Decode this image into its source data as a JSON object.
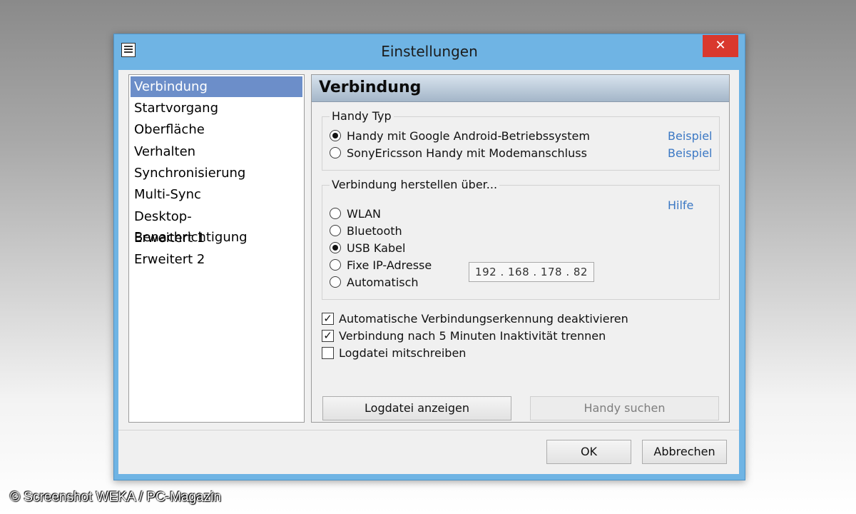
{
  "window": {
    "title": "Einstellungen",
    "close_symbol": "✕",
    "app_icon": "list-icon"
  },
  "nav": {
    "items": [
      {
        "label": "Verbindung",
        "selected": true
      },
      {
        "label": "Startvorgang"
      },
      {
        "label": "Oberfläche"
      },
      {
        "label": "Verhalten"
      },
      {
        "label": "Synchronisierung"
      },
      {
        "label": "Multi-Sync"
      },
      {
        "label": "Desktop-Benachrichtigung"
      },
      {
        "label": "Erweitert 1"
      },
      {
        "label": "Erweitert 2"
      }
    ]
  },
  "panel": {
    "title": "Verbindung",
    "handy_typ": {
      "label": "Handy Typ",
      "options": [
        {
          "label": "Handy mit Google Android-Betriebssystem",
          "checked": true,
          "link": "Beispiel"
        },
        {
          "label": "SonyEricsson Handy mit Modemanschluss",
          "checked": false,
          "link": "Beispiel"
        }
      ]
    },
    "verbindung_ueber": {
      "label": "Verbindung herstellen über...",
      "help_link": "Hilfe",
      "options": [
        {
          "label": "WLAN",
          "checked": false
        },
        {
          "label": "Bluetooth",
          "checked": false
        },
        {
          "label": "USB Kabel",
          "checked": true
        },
        {
          "label": "Fixe IP-Adresse",
          "checked": false
        },
        {
          "label": "Automatisch",
          "checked": false
        }
      ],
      "ip_address": "192 . 168 . 178 . 82"
    },
    "checkboxes": [
      {
        "label": "Automatische Verbindungserkennung deaktivieren",
        "checked": true
      },
      {
        "label": "Verbindung nach 5 Minuten Inaktivität trennen",
        "checked": true
      },
      {
        "label": "Logdatei mitschreiben",
        "checked": false
      }
    ],
    "buttons": {
      "show_log": "Logdatei anzeigen",
      "find_phone": "Handy suchen"
    }
  },
  "footer": {
    "ok": "OK",
    "cancel": "Abbrechen"
  },
  "watermark": "© Screenshot WEKA / PC-Magazin",
  "colors": {
    "selection": "#6c8ec9",
    "link": "#3b78c4",
    "close": "#d9382e",
    "frame": "#6fb4e4"
  }
}
